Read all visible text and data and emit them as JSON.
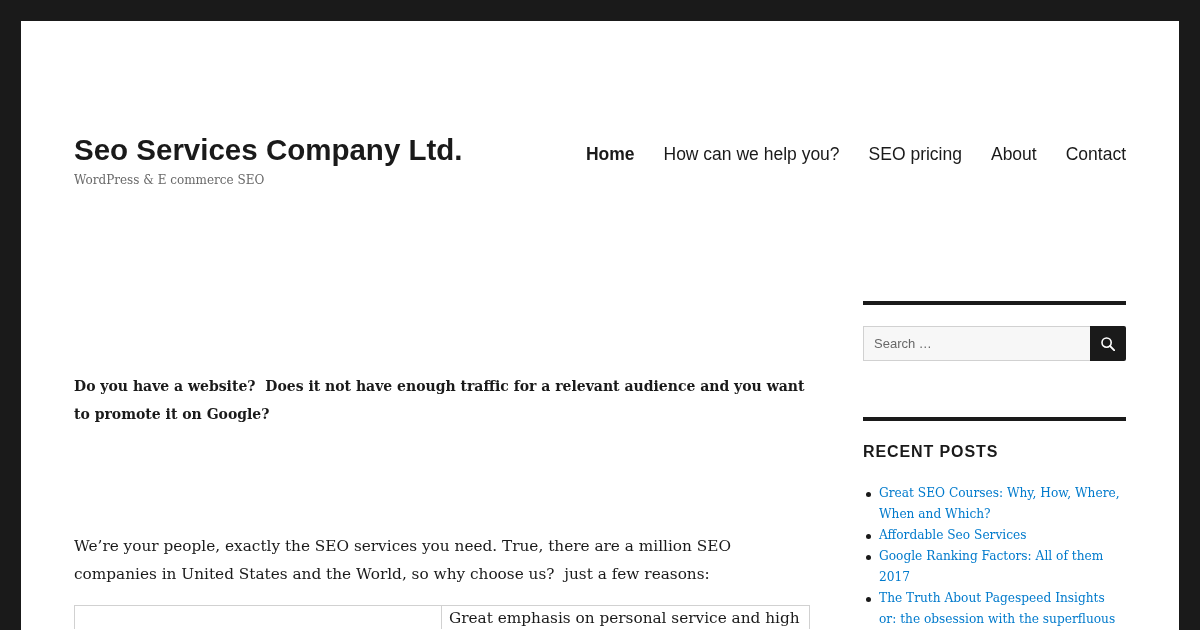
{
  "site": {
    "title": "Seo Services Company Ltd.",
    "tagline": "WordPress & E commerce SEO"
  },
  "nav": [
    {
      "label": "Home",
      "selected": true
    },
    {
      "label": "How can we help you?",
      "selected": false
    },
    {
      "label": "SEO pricing",
      "selected": false
    },
    {
      "label": "About",
      "selected": false
    },
    {
      "label": "Contact",
      "selected": false
    }
  ],
  "content": {
    "paragraphs": [
      {
        "kind": "bold",
        "text": "Do you have a website?  Does it not have enough traffic for a relevant audience and you want to promote it on Google?"
      },
      {
        "kind": "normal",
        "text": "We’re your people, exactly the SEO services you need. True, there are a million SEO companies in United States and the World, so why choose us?  just a few reasons:"
      }
    ],
    "table": {
      "rows": [
        {
          "column_2": "Great emphasis on personal service and high"
        }
      ]
    }
  },
  "sidebar": {
    "search": {
      "placeholder": "Search …"
    },
    "recent_posts": {
      "title": "RECENT POSTS",
      "items": [
        "Great SEO Courses: Why, How, Where, When and Which?",
        "Affordable Seo Services",
        "Google Ranking Factors: All of them 2017",
        "The Truth About Pagespeed Insights or: the obsession with the superfluous"
      ]
    }
  }
}
